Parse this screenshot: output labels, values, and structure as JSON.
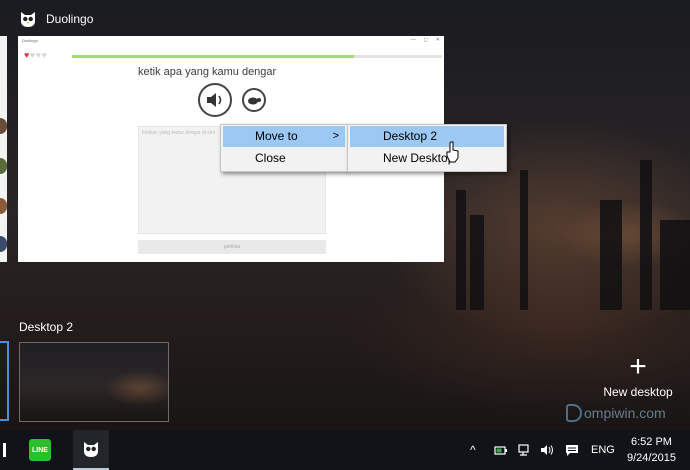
{
  "window": {
    "title": "Duolingo"
  },
  "app": {
    "title_bar": "Duolingo",
    "window_controls": [
      "—",
      "◻",
      "✕"
    ],
    "hearts": [
      "♥",
      "♥",
      "♥",
      "♥"
    ],
    "progress": 0.76,
    "prompt": "ketik apa yang kamu dengar",
    "input_placeholder": "ketikan yang kamu dengar di sini",
    "check_label": "periksa"
  },
  "context_menu": {
    "items": [
      {
        "label": "Move to",
        "arrow": ">"
      },
      {
        "label": "Close"
      }
    ],
    "submenu": [
      {
        "label": "Desktop 2"
      },
      {
        "label": "New Desktop"
      }
    ]
  },
  "desktops": {
    "items": [
      {
        "label": "Desktop 2"
      }
    ],
    "new_desktop": {
      "plus": "+",
      "label": "New desktop"
    }
  },
  "watermark": {
    "text": "ompiwin.com"
  },
  "taskbar": {
    "apps": [
      {
        "name": "LINE",
        "text": "LINE"
      },
      {
        "name": "Duolingo"
      }
    ],
    "tray": {
      "chevron": "^",
      "lang": "ENG"
    },
    "clock": {
      "time": "6:52 PM",
      "date": "9/24/2015"
    }
  },
  "colors": {
    "menu_highlight": "#9cc8f4",
    "progress_green": "#a6db6e",
    "heart_red": "#e53935",
    "line_green": "#2dbd2d",
    "desktop_border": "#4d8fd4"
  },
  "icons": [
    "duolingo-owl-icon",
    "speaker-icon",
    "turtle-icon",
    "chevron-right-icon",
    "plus-icon",
    "line-app-icon",
    "network-icon",
    "volume-icon",
    "notification-icon",
    "battery-icon"
  ]
}
